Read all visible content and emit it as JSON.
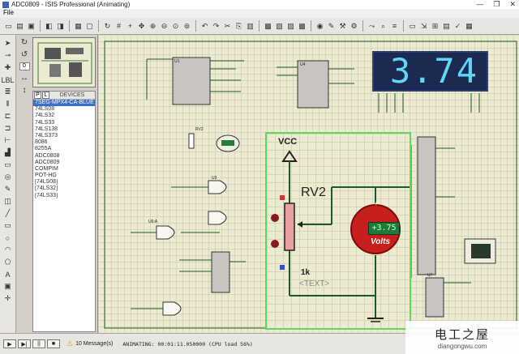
{
  "window": {
    "title": "ADC0809 - ISIS Professional (Animating)",
    "controls": [
      "—",
      "❐",
      "✕"
    ]
  },
  "menu": {
    "items": [
      "File"
    ]
  },
  "toolbar": {
    "icons": [
      "new-icon",
      "open-icon",
      "save-icon",
      "import-icon",
      "export-icon",
      "print-icon",
      "area-icon",
      "refresh-icon",
      "grid-icon",
      "origin-icon",
      "pan-icon",
      "zoom-in-icon",
      "zoom-out-icon",
      "zoom-all-icon",
      "zoom-area-icon",
      "undo-icon",
      "redo-icon",
      "cut-icon",
      "copy-icon",
      "paste-icon",
      "block-copy-icon",
      "block-move-icon",
      "block-rotate-icon",
      "block-delete-icon",
      "pick-icon",
      "make-device-icon",
      "pack-icon",
      "decompose-icon",
      "wire-autoroute-icon",
      "search-icon",
      "property-icon",
      "sheet-icon",
      "goto-icon",
      "netlist-icon",
      "bom-icon",
      "erc-icon",
      "ares-icon"
    ]
  },
  "devices": {
    "header_p": "P",
    "header_l": "L",
    "title": "DEVICES",
    "items": [
      "7SEG-MPX4-CA-BLUE",
      "74LS08",
      "74LS32",
      "74LS33",
      "74LS138",
      "74LS373",
      "8086",
      "8255A",
      "ADC0808",
      "ADC0809",
      "COMPIM",
      "POT-HG",
      "[74LS08]",
      "[74LS32]",
      "[74LS33]"
    ],
    "selected_index": 0
  },
  "rotation": {
    "value": "0"
  },
  "display": {
    "digits": "3.74",
    "color": "#5fd8f8"
  },
  "zoom": {
    "vcc": "VCC",
    "rv": "RV2",
    "meter_value": "+3.75",
    "meter_unit": "Volts",
    "resistance": "1k",
    "text_placeholder": "<TEXT>"
  },
  "chips": {
    "u1": "U1",
    "u4": "U4",
    "rv2_small": "RV2",
    "u3": "U3",
    "u6": "U6:A",
    "u7": "U7"
  },
  "status": {
    "messages": "10 Message(s)",
    "animating": "ANIMATING: 00:01:11.050000 (CPU load 56%)"
  },
  "watermark": {
    "cn": "电工之屋",
    "en": "diangongwu.com"
  },
  "colors": {
    "selection": "#3a6ec8",
    "wire": "#1a5a2a",
    "zoom_border": "#5fd860",
    "canvas": "#ecead0"
  }
}
